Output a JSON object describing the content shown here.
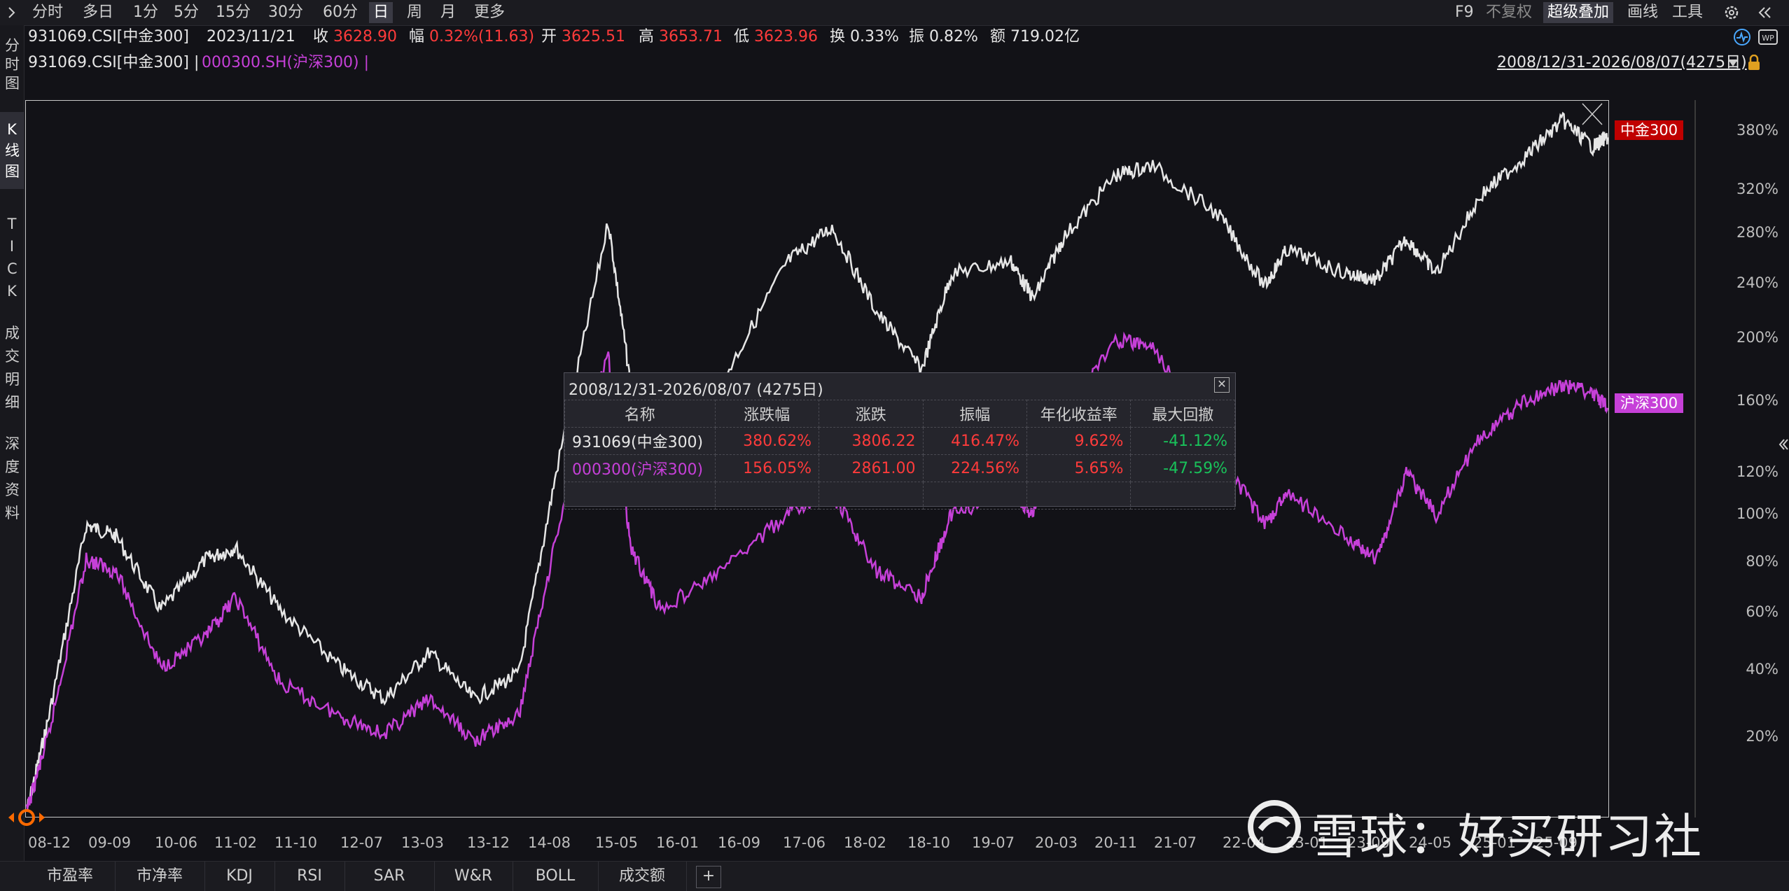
{
  "toolbar": {
    "expand_icon": "chevron-right-icon",
    "periods": [
      "分时",
      "多日",
      "1分",
      "5分",
      "15分",
      "30分",
      "60分",
      "日",
      "周",
      "月",
      "更多"
    ],
    "active_period": "日",
    "right": {
      "f9": "F9",
      "adjust": "不复权",
      "overlay": "超级叠加",
      "draw": "画线",
      "tools": "工具",
      "settings_icon": "gear-icon",
      "collapse_icon": "double-chevron-left-icon"
    }
  },
  "quote": {
    "code": "931069.CSI[中金300]",
    "date": "2023/11/21",
    "close_label": "收",
    "close": "3628.90",
    "change_label": "幅",
    "change": "0.32%(11.63)",
    "open_label": "开",
    "open": "3625.51",
    "high_label": "高",
    "high": "3653.71",
    "low_label": "低",
    "low": "3623.96",
    "turnover_label": "换",
    "turnover": "0.33%",
    "amplitude_label": "振",
    "amplitude": "0.82%",
    "amount_label": "额",
    "amount": "719.02亿"
  },
  "overlay_line": {
    "main": "931069.CSI[中金300] |",
    "secondary": "000300.SH(沪深300) |",
    "range": "2008/12/31-2026/08/07(4275日)"
  },
  "left_tabs": [
    {
      "label": "分时图"
    },
    {
      "label": "K线图"
    },
    {
      "label": "TICK"
    },
    {
      "label": "成交明细"
    },
    {
      "label": "深度资料"
    }
  ],
  "chart_data": {
    "type": "line",
    "y_scale": "log",
    "y_ticks": [
      "380%",
      "320%",
      "280%",
      "240%",
      "200%",
      "160%",
      "120%",
      "100%",
      "80%",
      "60%",
      "40%",
      "20%"
    ],
    "x_ticks": [
      "08-12",
      "09-09",
      "10-06",
      "11-02",
      "11-10",
      "12-07",
      "13-03",
      "13-12",
      "14-08",
      "15-05",
      "16-01",
      "16-09",
      "17-06",
      "18-02",
      "18-10",
      "19-07",
      "20-03",
      "20-11",
      "21-07",
      "22-04",
      "23-01",
      "23-09",
      "24-05",
      "25-01",
      "25-09"
    ],
    "series": [
      {
        "name": "中金300",
        "color": "#e6e6e6",
        "x": [
          "08-12",
          "09-03",
          "09-08",
          "09-12",
          "10-06",
          "10-12",
          "11-04",
          "11-10",
          "12-06",
          "12-12",
          "13-06",
          "13-12",
          "14-06",
          "14-11",
          "15-06",
          "15-09",
          "16-01",
          "16-09",
          "17-06",
          "17-12",
          "18-06",
          "18-12",
          "19-04",
          "19-12",
          "20-03",
          "20-07",
          "21-02",
          "21-07",
          "22-04",
          "22-10",
          "23-01",
          "23-09",
          "24-01",
          "24-05",
          "24-09",
          "25-03",
          "25-09",
          "26-02",
          "26-06",
          "26-08"
        ],
        "values": [
          0,
          25,
          95,
          90,
          60,
          80,
          85,
          60,
          40,
          30,
          45,
          30,
          38,
          120,
          295,
          170,
          160,
          170,
          260,
          290,
          220,
          180,
          250,
          260,
          230,
          280,
          340,
          350,
          300,
          240,
          270,
          250,
          245,
          280,
          250,
          320,
          360,
          400,
          370,
          380.62
        ]
      },
      {
        "name": "沪深300",
        "color": "#c640d8",
        "x": [
          "08-12",
          "09-03",
          "09-08",
          "09-12",
          "10-06",
          "10-12",
          "11-04",
          "11-10",
          "12-06",
          "12-12",
          "13-06",
          "13-12",
          "14-06",
          "14-11",
          "15-06",
          "15-09",
          "16-01",
          "16-09",
          "17-06",
          "17-12",
          "18-06",
          "18-12",
          "19-04",
          "19-12",
          "20-03",
          "20-07",
          "21-02",
          "21-07",
          "22-04",
          "22-10",
          "23-01",
          "23-09",
          "24-01",
          "24-05",
          "24-09",
          "25-03",
          "25-09",
          "26-02",
          "26-06",
          "26-08"
        ],
        "values": [
          0,
          20,
          80,
          75,
          40,
          50,
          65,
          35,
          25,
          20,
          30,
          18,
          25,
          90,
          190,
          85,
          60,
          75,
          100,
          110,
          75,
          65,
          100,
          110,
          100,
          150,
          200,
          195,
          130,
          95,
          110,
          90,
          80,
          120,
          100,
          140,
          160,
          170,
          165,
          156.05
        ]
      }
    ],
    "labels": {
      "main": "中金300",
      "secondary": "沪深300"
    }
  },
  "popup": {
    "title": "2008/12/31-2026/08/07 (4275日)",
    "close_icon": "close-icon",
    "headers": [
      "名称",
      "涨跌幅",
      "涨跌",
      "振幅",
      "年化收益率",
      "最大回撤"
    ],
    "rows": [
      {
        "name": "931069(中金300)",
        "pct": "380.62%",
        "chg": "3806.22",
        "amp": "416.47%",
        "annual": "9.62%",
        "dd": "-41.12%"
      },
      {
        "name": "000300(沪深300)",
        "pct": "156.05%",
        "chg": "2861.00",
        "amp": "224.56%",
        "annual": "5.65%",
        "dd": "-47.59%"
      }
    ]
  },
  "bottom_tabs": [
    "市盈率",
    "市净率",
    "KDJ",
    "RSI",
    "SAR",
    "W&R",
    "BOLL",
    "成交额"
  ],
  "add_tab_icon": "plus-icon",
  "watermark": "雪球：好买研习社",
  "colors": {
    "background": "#121217",
    "up": "#ff3b3b",
    "down": "#19c15a",
    "overlay": "#c640d8",
    "main_tag": "#c00000"
  }
}
